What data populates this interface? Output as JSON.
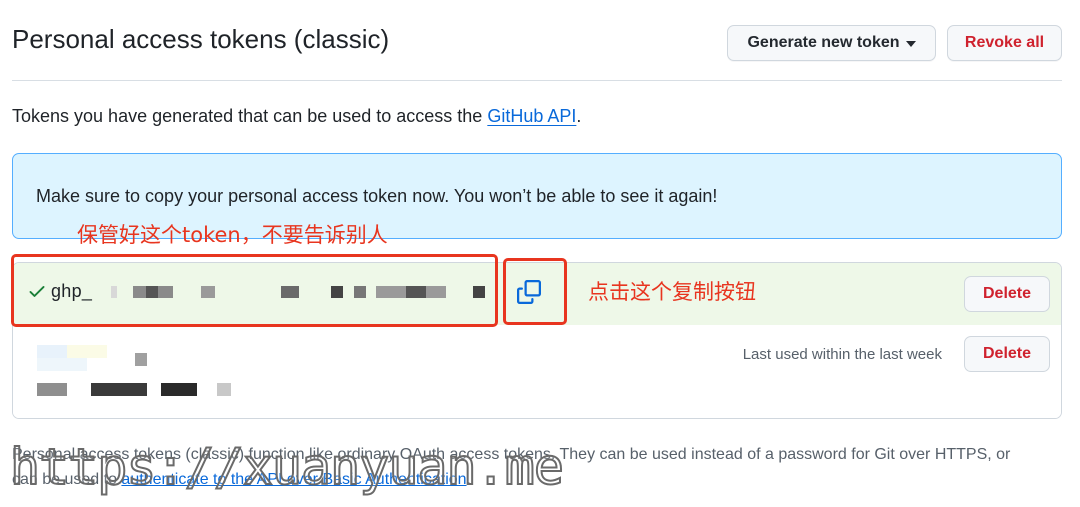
{
  "header": {
    "title": "Personal access tokens (classic)",
    "generate_label": "Generate new token",
    "revoke_label": "Revoke all"
  },
  "intro": {
    "text": "Tokens you have generated that can be used to access the ",
    "link": "GitHub API",
    "suffix": "."
  },
  "flash": {
    "message": "Make sure to copy your personal access token now. You won’t be able to see it again!"
  },
  "annotations": {
    "keep_safe": "保管好这个token，不要告诉别人",
    "click_copy": "点击这个复制按钮",
    "color": "#e8351f"
  },
  "tokens": [
    {
      "prefix": "ghp_",
      "delete_label": "Delete",
      "status_color": "#1a7f37",
      "icons": [
        "check-icon",
        "copy-icon"
      ]
    },
    {
      "last_used": "Last used within the last week",
      "delete_label": "Delete"
    }
  ],
  "footer": {
    "text1": "Personal access tokens (classic) function like ordinary OAuth access tokens. They can be used instead of a password for Git over HTTPS, or can be used to ",
    "link": "authenticate to the API over Basic Authentication",
    "text2": "."
  },
  "watermark": "https://xuanyuan.me",
  "colors": {
    "link": "#0969da",
    "danger": "#cf222e",
    "flash_bg": "#ddf4ff",
    "flash_border": "#54aeff",
    "success_bg": "#eef8e8"
  }
}
